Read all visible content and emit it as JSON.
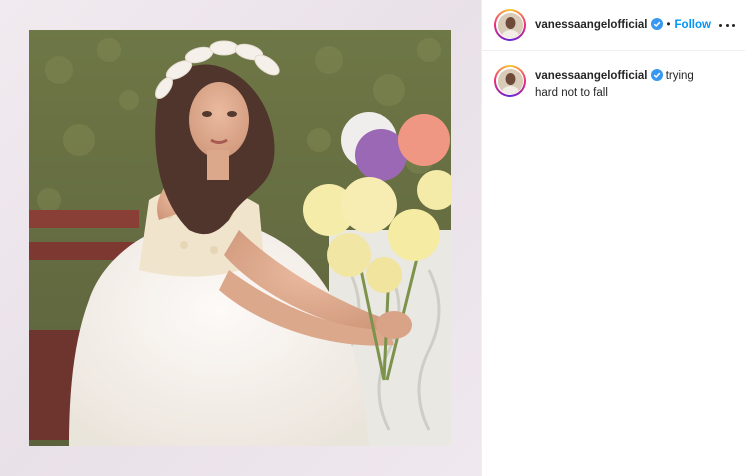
{
  "post": {
    "username": "vanessaangelofficial",
    "follow_label": "Follow",
    "separator": "•",
    "caption_text": "trying hard not to fall"
  },
  "colors": {
    "follow": "#0095f6",
    "verified": "#3897f0",
    "text": "#262626",
    "frame": "#ece4ea"
  },
  "icons": {
    "verified": "verified-badge-icon",
    "more": "more-options-icon"
  }
}
